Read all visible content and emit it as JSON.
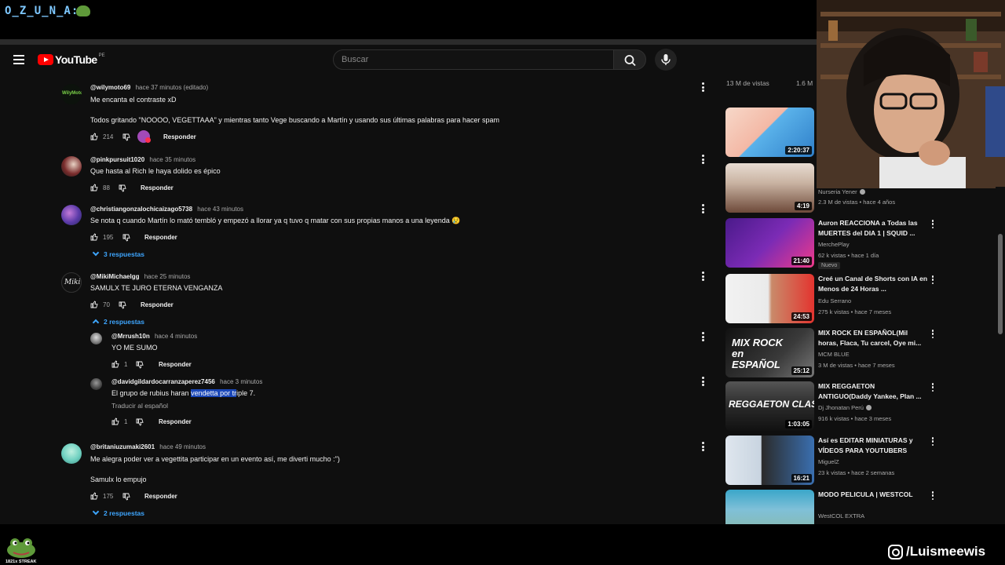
{
  "overlay": {
    "handle": "O_Z_U_N_A:",
    "streak_label": "1821x STREAK",
    "social_handle": "/Luismeewis"
  },
  "masthead": {
    "logo_text": "YouTube",
    "country_code": "PE",
    "search_placeholder": "Buscar"
  },
  "comments": [
    {
      "user": "@wilymoto69",
      "time": "hace 37 minutos (editado)",
      "lines": [
        "Me encanta el contraste xD",
        "Todos gritando \"NOOOO, VEGETTAAA\" y mientras tanto Vege buscando a Martín y usando sus últimas palabras para hacer spam"
      ],
      "likes": "214",
      "reply_label": "Responder"
    },
    {
      "user": "@pinkpursuit1020",
      "time": "hace 35 minutos",
      "lines": [
        "Que hasta al Rich le haya dolido es épico"
      ],
      "likes": "88",
      "reply_label": "Responder"
    },
    {
      "user": "@christiangonzalochicaizago5738",
      "time": "hace 43 minutos",
      "lines": [
        "Se nota q cuando Martín lo mató tembló y empezó a llorar ya q tuvo q matar con sus propias manos a una leyenda 😢"
      ],
      "likes": "195",
      "reply_label": "Responder",
      "replies_toggle": "3 respuestas"
    },
    {
      "user": "@MikiMichaelgg",
      "time": "hace 25 minutos",
      "lines": [
        "SAMULX TE JURO ETERNA VENGANZA"
      ],
      "likes": "70",
      "reply_label": "Responder",
      "replies_toggle": "2 respuestas"
    },
    {
      "user": "@britaniuzumaki2601",
      "time": "hace 49 minutos",
      "lines": [
        "Me alegra poder ver a vegettita participar en un evento así, me diverti mucho :\")",
        "Samulx lo empujo"
      ],
      "likes": "175",
      "reply_label": "Responder",
      "replies_toggle": "2 respuestas"
    }
  ],
  "replies": [
    {
      "user": "@Mrrush10n",
      "time": "hace 4 minutos",
      "text": "YO ME SUMO",
      "likes": "1",
      "reply_label": "Responder"
    },
    {
      "user": "@davidgildardocarranzaperez7456",
      "time": "hace 3 minutos",
      "text_before": "El grupo de rubius haran ",
      "text_highlight": "vendetta por tr",
      "text_after": "iple 7.",
      "translate_label": "Traducir al español",
      "likes": "1",
      "reply_label": "Responder"
    }
  ],
  "sidebar": {
    "top_partial": {
      "views_left": "13 M de vistas",
      "views_right": "1.6 M"
    },
    "videos": [
      {
        "duration": "2:20:37",
        "color_a": "#f7d8c9",
        "color_b": "#5ab2ea"
      },
      {
        "duration": "4:19",
        "channel": "Nurseria Yener",
        "meta": "2.3 M de vistas • hace 4 años",
        "color_a": "#d7c5b8",
        "color_b": "#6e4a3a"
      },
      {
        "duration": "21:40",
        "title": "Auron REACCIONA a Todas las MUERTES del DIA 1 | SQUID ...",
        "channel": "MerchePlay",
        "meta": "62 k vistas • hace 1 día",
        "badge": "Nuevo",
        "color_a": "#7b2bb5",
        "color_b": "#f03a8a"
      },
      {
        "duration": "24:53",
        "title": "Creé un Canal de Shorts con IA en Menos de 24 Horas ...",
        "channel": "Edu Serrano",
        "meta": "275 k vistas • hace 7 meses",
        "color_a": "#f2f2f2",
        "color_b": "#e3342f"
      },
      {
        "duration": "25:12",
        "title": "MIX ROCK EN ESPAÑOL(Mil horas, Flaca, Tu carcel, Oye mi...",
        "channel": "MCM BLUE",
        "meta": "3 M de vistas • hace 7 meses",
        "thumb_text": "MIX ROCK en ESPAÑOL",
        "color_a": "#1b1b1b",
        "color_b": "#555555"
      },
      {
        "duration": "1:03:05",
        "title": "MIX REGGAETON ANTIGUO(Daddy Yankee, Plan ...",
        "channel": "Dj Jhonatan Perú",
        "meta": "916 k vistas • hace 3 meses",
        "thumb_text": "REGGAETON CLASICO",
        "color_a": "#2a2a2a",
        "color_b": "#777777"
      },
      {
        "duration": "16:21",
        "title": "Así es EDITAR MINIATURAS y VÍDEOS PARA YOUTUBERS",
        "channel": "MiguelZ",
        "meta": "23 k vistas • hace 2 semanas",
        "color_a": "#dfe6ee",
        "color_b": "#3a6fb0"
      },
      {
        "title": "MODO PELICULA | WESTCOL",
        "channel": "WestCOL EXTRA",
        "meta": "",
        "color_a": "#3aa6c9",
        "color_b": "#8bb8a0"
      }
    ]
  },
  "colors": {
    "bg": "#0f0f0f",
    "link_blue": "#3ea6ff",
    "youtube_red": "#ff0000",
    "selection": "#1a47b8"
  }
}
